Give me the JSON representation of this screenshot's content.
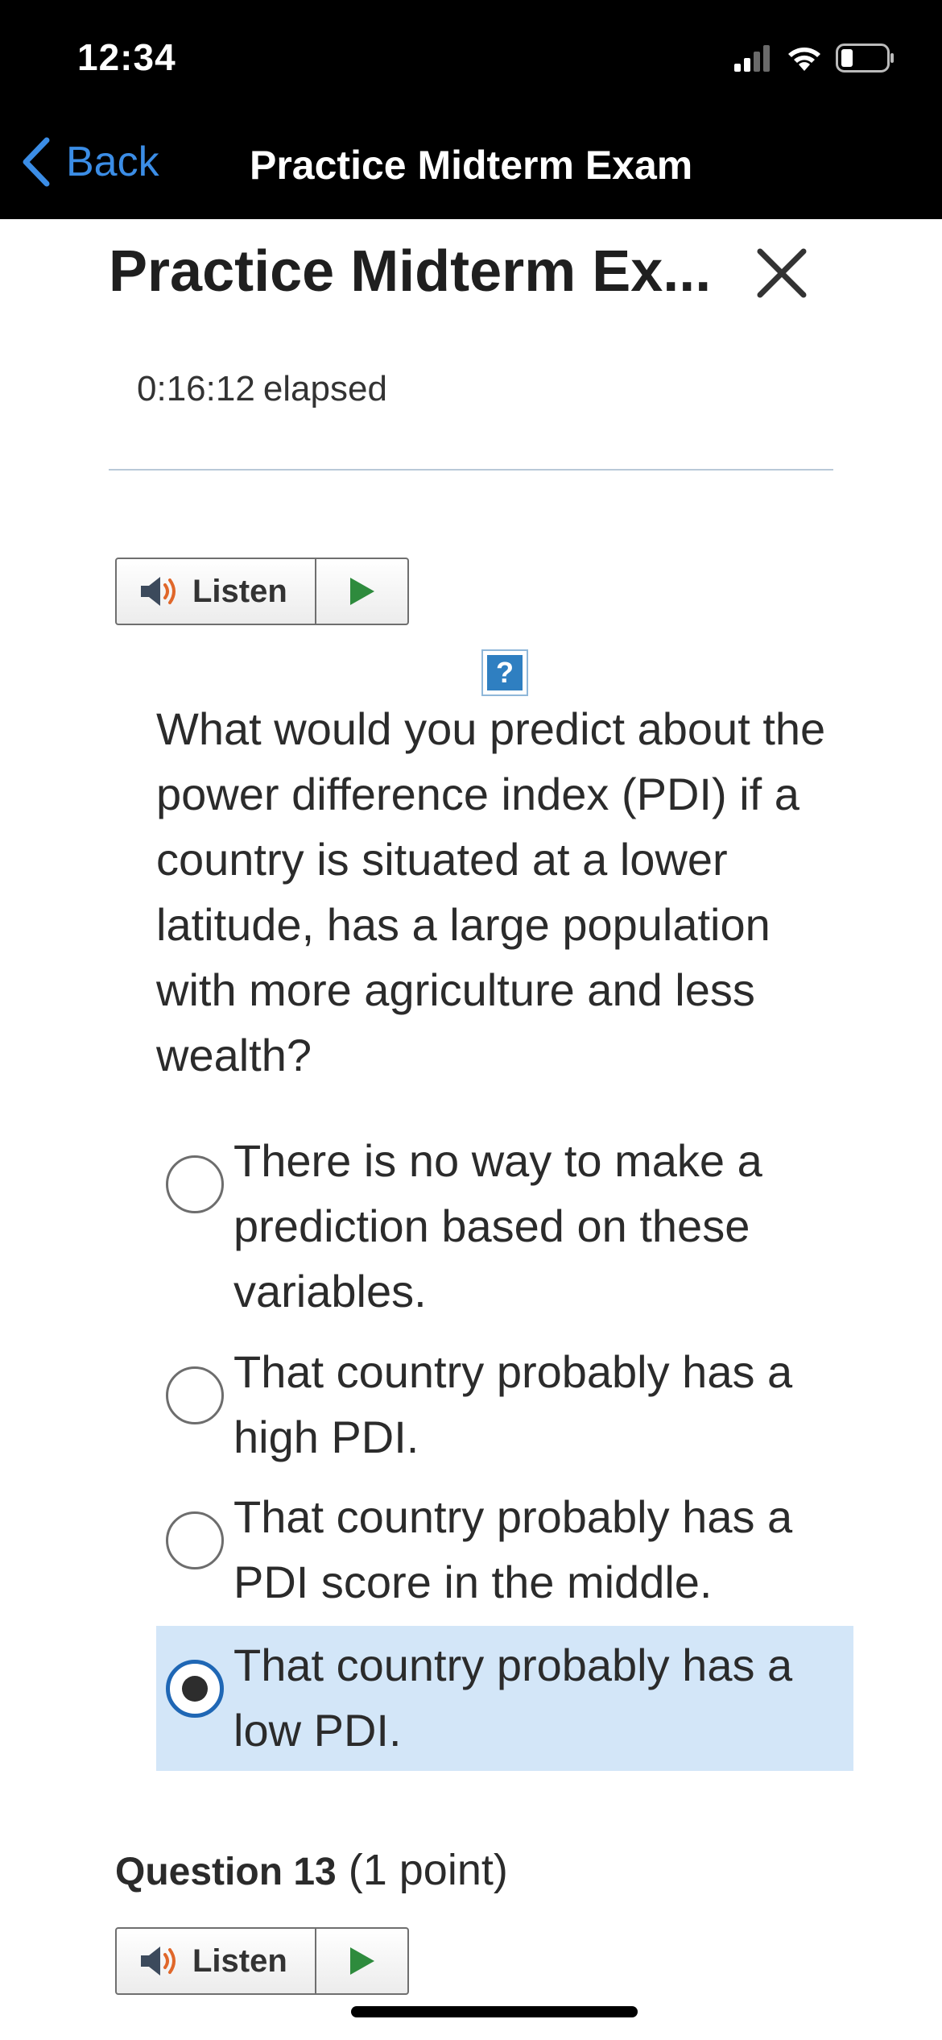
{
  "status_bar": {
    "time": "12:34"
  },
  "nav": {
    "back_label": "Back",
    "title": "Practice Midterm Exam"
  },
  "header": {
    "exam_title": "Practice Midterm Ex...",
    "elapsed_time": "0:16:12",
    "elapsed_label": "elapsed"
  },
  "listen": {
    "label": "Listen"
  },
  "question12": {
    "help_glyph": "?",
    "text": "What would you predict about the power difference index (PDI) if a country is situated at a lower latitude, has a large population with more agriculture and less wealth?",
    "options": [
      {
        "label": "There is no way to make a prediction based on these variables.",
        "selected": false
      },
      {
        "label": "That country probably has a high PDI.",
        "selected": false
      },
      {
        "label": "That country probably has a PDI score in the middle.",
        "selected": false
      },
      {
        "label": "That country probably has a low PDI.",
        "selected": true
      }
    ]
  },
  "question13": {
    "title": "Question 13",
    "points": "(1 point)"
  },
  "colors": {
    "accent": "#3b8de6",
    "selected_bg": "#d3e6f8",
    "radio_checked": "#1f67b5"
  },
  "icons": [
    "back-chevron-icon",
    "close-icon",
    "speaker-icon",
    "play-icon",
    "help-icon",
    "signal-icon",
    "wifi-icon",
    "battery-icon"
  ]
}
